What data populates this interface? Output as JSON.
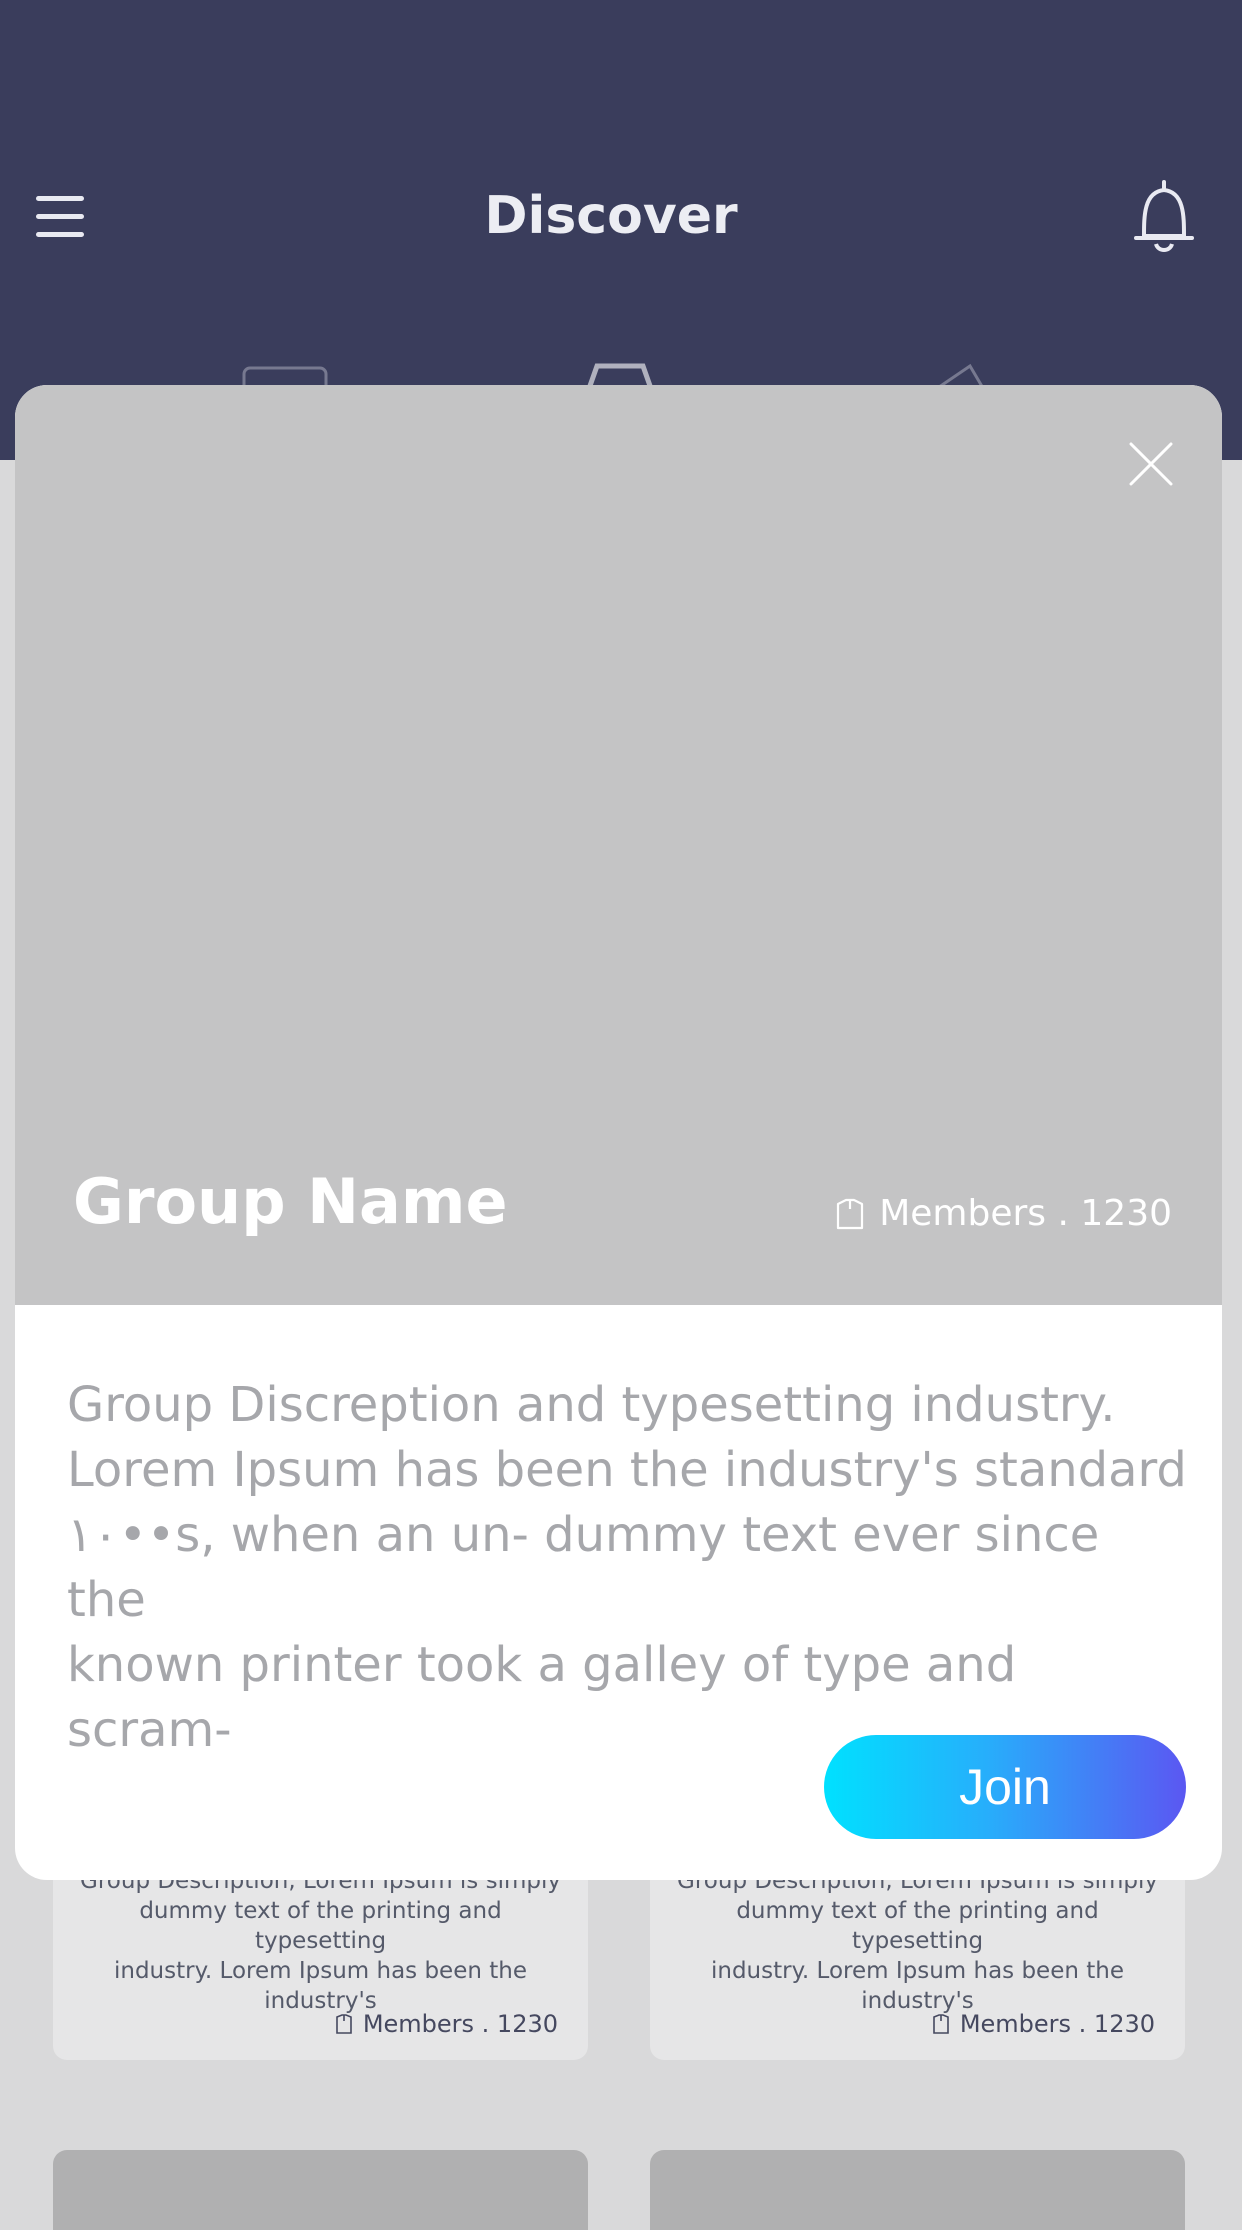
{
  "header": {
    "title": "Discover",
    "menu_icon": "hamburger-menu-icon",
    "notification_icon": "bell-icon"
  },
  "modal": {
    "group_name": "Group Name",
    "members_label": "Members . 1230",
    "members_icon": "shirt-icon",
    "description_lines": [
      "Group Discreption and typesetting industry.",
      "Lorem Ipsum has been the industry's standard",
      "١٠••s, when an un- dummy text ever since the",
      "known printer took a galley of type and scram-"
    ],
    "join_label": "Join",
    "close_icon": "close-icon"
  },
  "cards": [
    {
      "description_lines": [
        "Group Description, Lorem Ipsum is simply",
        "dummy text of the printing and typesetting",
        "industry. Lorem Ipsum has been the industry's"
      ],
      "members_label": "Members . 1230"
    },
    {
      "description_lines": [
        "Group Description, Lorem Ipsum is simply",
        "dummy text of the printing and typesetting",
        "industry. Lorem Ipsum has been the industry's"
      ],
      "members_label": "Members . 1230"
    }
  ],
  "colors": {
    "header_bg": "#3a3d5c",
    "join_gradient_start": "#00e1ff",
    "join_gradient_end": "#5b57f2"
  }
}
